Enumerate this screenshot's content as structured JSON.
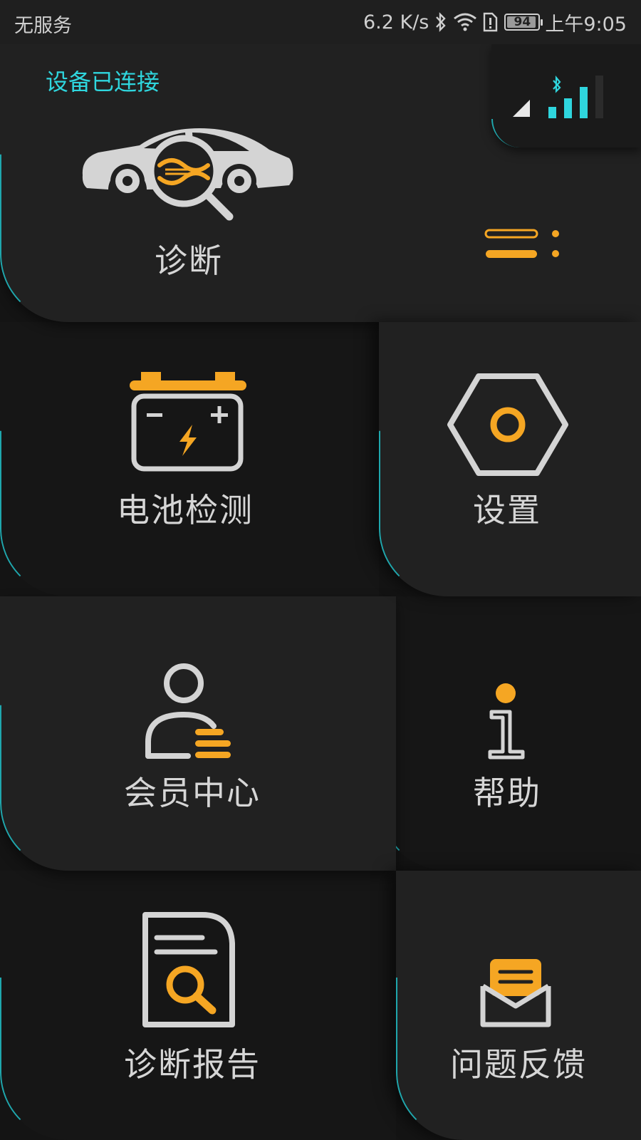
{
  "status_bar": {
    "carrier": "无服务",
    "net_speed": "6.2 K/s",
    "battery_level": "94",
    "battery_fraction": 0.94,
    "time": "上午9:05",
    "icons": [
      "bluetooth-icon",
      "wifi-icon",
      "sim-alert-icon",
      "battery-icon"
    ]
  },
  "header": {
    "connection_status": "设备已连接",
    "signal_icons": [
      "bluetooth-icon",
      "signal-bars-icon",
      "cellular-triangle-icon"
    ],
    "menu_icon": "menu-lines-icon"
  },
  "tiles": {
    "diagnose": {
      "label": "诊断",
      "icon": "car-diagnostic-icon"
    },
    "battery": {
      "label": "电池检测",
      "icon": "car-battery-icon"
    },
    "settings": {
      "label": "设置",
      "icon": "hex-nut-icon"
    },
    "member": {
      "label": "会员中心",
      "icon": "user-profile-icon"
    },
    "help": {
      "label": "帮助",
      "icon": "info-icon"
    },
    "report": {
      "label": "诊断报告",
      "icon": "report-search-icon"
    },
    "feedback": {
      "label": "问题反馈",
      "icon": "envelope-letter-icon"
    }
  },
  "colors": {
    "accent_orange": "#f5a623",
    "accent_cyan": "#2fd6de",
    "tile_light": "#212121",
    "tile_dark": "#161616",
    "icon_grey": "#d4d4d4"
  }
}
